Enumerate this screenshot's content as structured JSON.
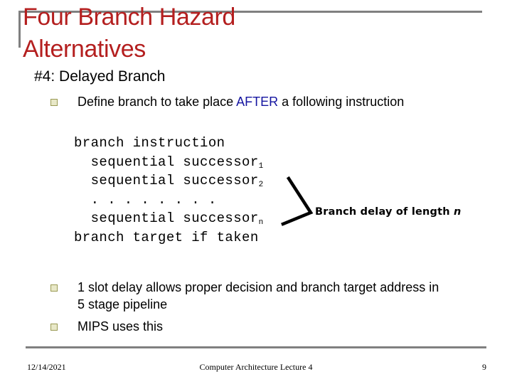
{
  "slide": {
    "title": "Four Branch Hazard\nAlternatives",
    "title_color": "#B41F1F",
    "rule_color": "#808080"
  },
  "content": {
    "heading": "#4: Delayed Branch",
    "bullet_1": {
      "text_before": "Define branch to take place ",
      "highlight": "AFTER",
      "highlight_color": "#1414A0",
      "text_after": " a following instruction"
    },
    "code": {
      "line_1": "branch instruction",
      "line_2_text": "  sequential successor",
      "line_2_sub": "1",
      "line_3_text": "  sequential successor",
      "line_3_sub": "2",
      "line_4": "  . . . . . . . .",
      "line_5_text": "  sequential successor",
      "line_5_sub": "n",
      "line_6": "branch target if taken"
    },
    "callout": {
      "text": "Branch delay of length ",
      "italic": "n"
    },
    "bullet_2": "1 slot delay allows proper decision and branch target address in 5 stage pipeline",
    "bullet_3": "MIPS uses this"
  },
  "footer": {
    "date": "12/14/2021",
    "center": "Computer Architecture Lecture 4",
    "page": "9"
  }
}
